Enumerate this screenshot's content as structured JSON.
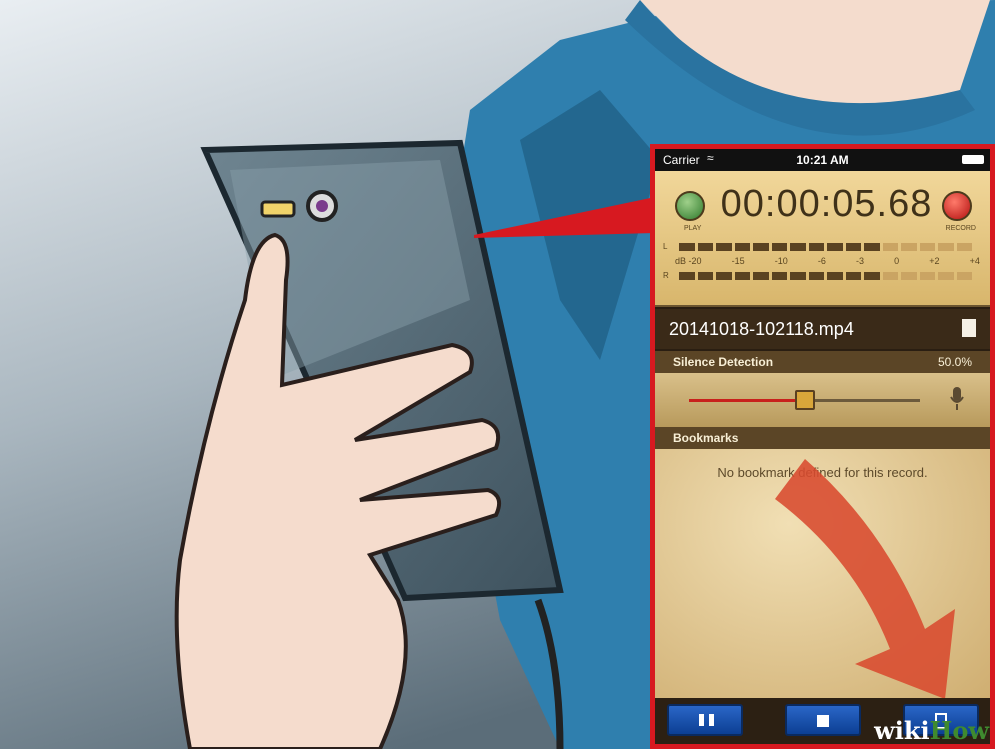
{
  "status_bar": {
    "carrier": "Carrier",
    "time": "10:21 AM"
  },
  "recorder": {
    "timer": "00:00:05.68",
    "play_label": "PLAY",
    "record_label": "RECORD",
    "left_channel": "L",
    "right_channel": "R",
    "db_scale": [
      "dB -20",
      "-15",
      "-10",
      "-6",
      "-3",
      "0",
      "+2",
      "+4"
    ]
  },
  "file": {
    "name": "20141018-102118.mp4"
  },
  "silence_detection": {
    "label": "Silence Detection",
    "value_text": "50.0%",
    "level": 0.5
  },
  "bookmarks": {
    "label": "Bookmarks",
    "empty_message": "No bookmark defined for this record."
  },
  "watermark": {
    "part1": "wiki",
    "part2": "How"
  },
  "colors": {
    "highlight_border": "#d71920",
    "arrow": "#d84a2f",
    "button_blue": "#1a4fa8"
  },
  "icons": [
    "wifi-icon",
    "battery-icon",
    "play-icon",
    "record-icon",
    "bookmark-icon",
    "microphone-icon",
    "pause-icon",
    "stop-icon",
    "list-icon"
  ]
}
